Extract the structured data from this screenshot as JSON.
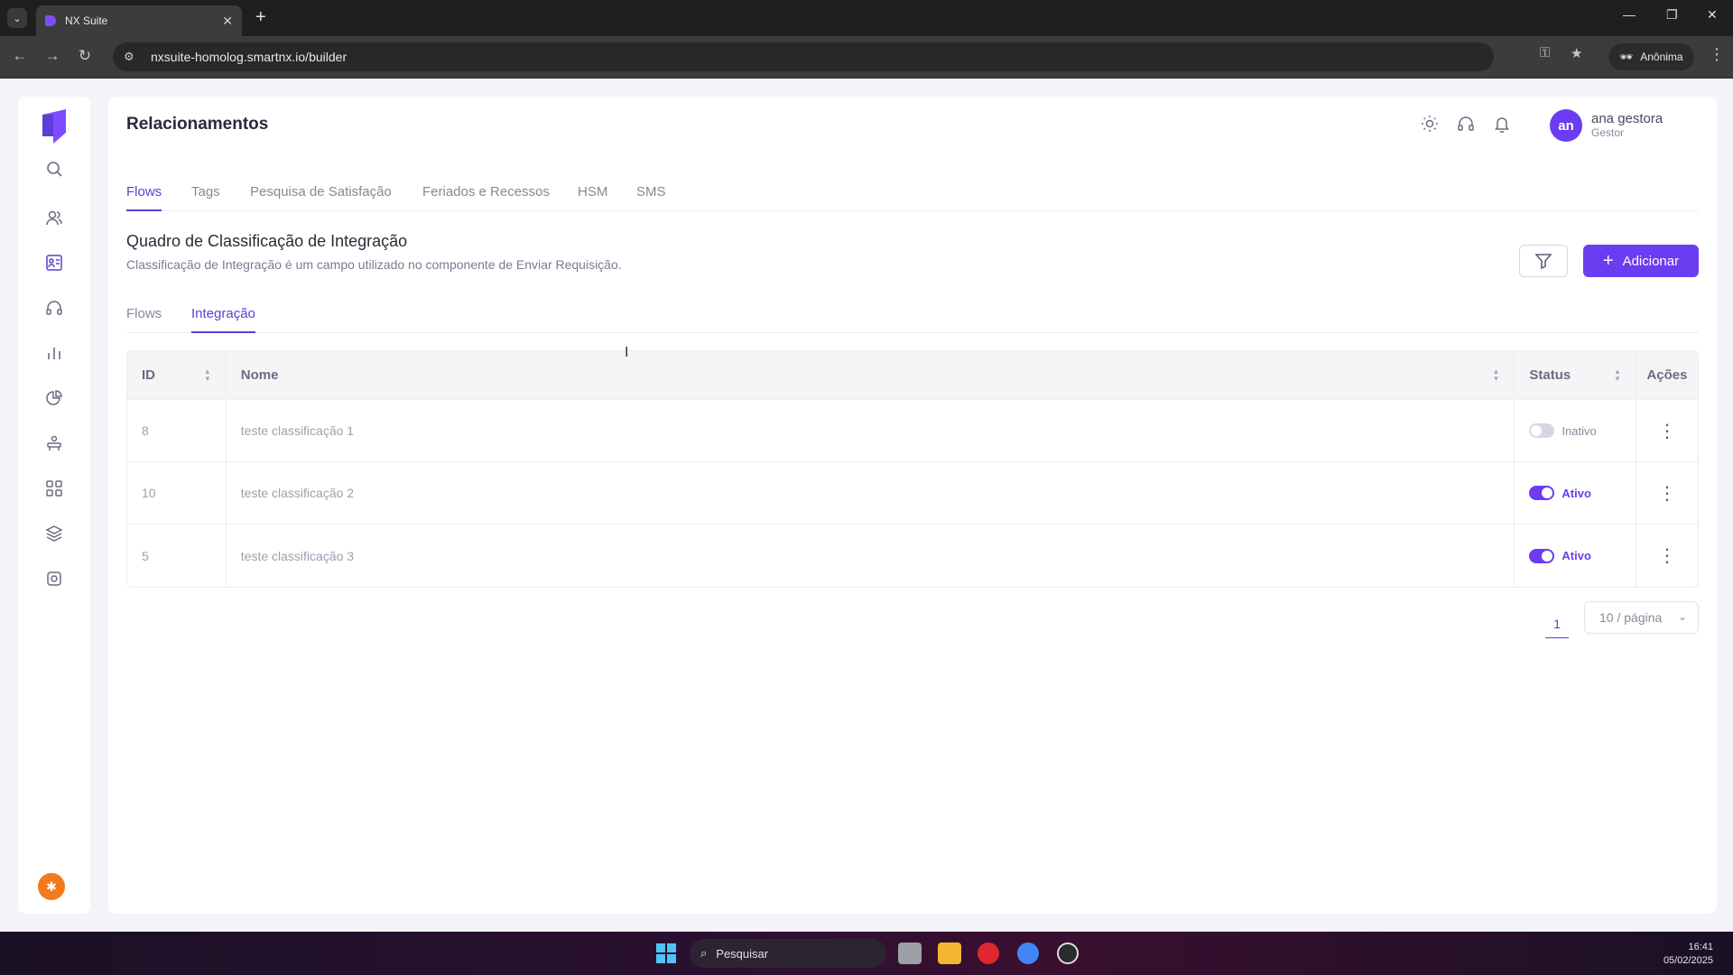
{
  "browser": {
    "tab_title": "NX Suite",
    "url": "nxsuite-homolog.smartnx.io/builder",
    "profile_label": "Anônima"
  },
  "header": {
    "title": "Relacionamentos",
    "user_initials": "an",
    "user_name": "ana gestora",
    "user_role": "Gestor"
  },
  "main_tabs": [
    "Flows",
    "Tags",
    "Pesquisa de Satisfação",
    "Feriados e Recessos",
    "HSM",
    "SMS"
  ],
  "section": {
    "title": "Quadro de Classificação de Integração",
    "description": "Classificação de Integração é um campo utilizado no componente de Enviar Requisição."
  },
  "actions": {
    "add_label": "Adicionar"
  },
  "sub_tabs": [
    "Flows",
    "Integração"
  ],
  "table": {
    "headers": {
      "id": "ID",
      "nome": "Nome",
      "status": "Status",
      "acoes": "Ações"
    },
    "rows": [
      {
        "id": "8",
        "nome": "teste classificação 1",
        "status": "Inativo",
        "active": false
      },
      {
        "id": "10",
        "nome": "teste classificação 2",
        "status": "Ativo",
        "active": true
      },
      {
        "id": "5",
        "nome": "teste classificação 3",
        "status": "Ativo",
        "active": true
      }
    ]
  },
  "pagination": {
    "current_page": "1",
    "page_size": "10 / página"
  },
  "taskbar": {
    "search_placeholder": "Pesquisar",
    "time": "16:41",
    "date": "05/02/2025"
  },
  "colors": {
    "accent": "#6b3cf0",
    "accent_text": "#5b3fd6",
    "bug_button": "#f07a1d"
  }
}
